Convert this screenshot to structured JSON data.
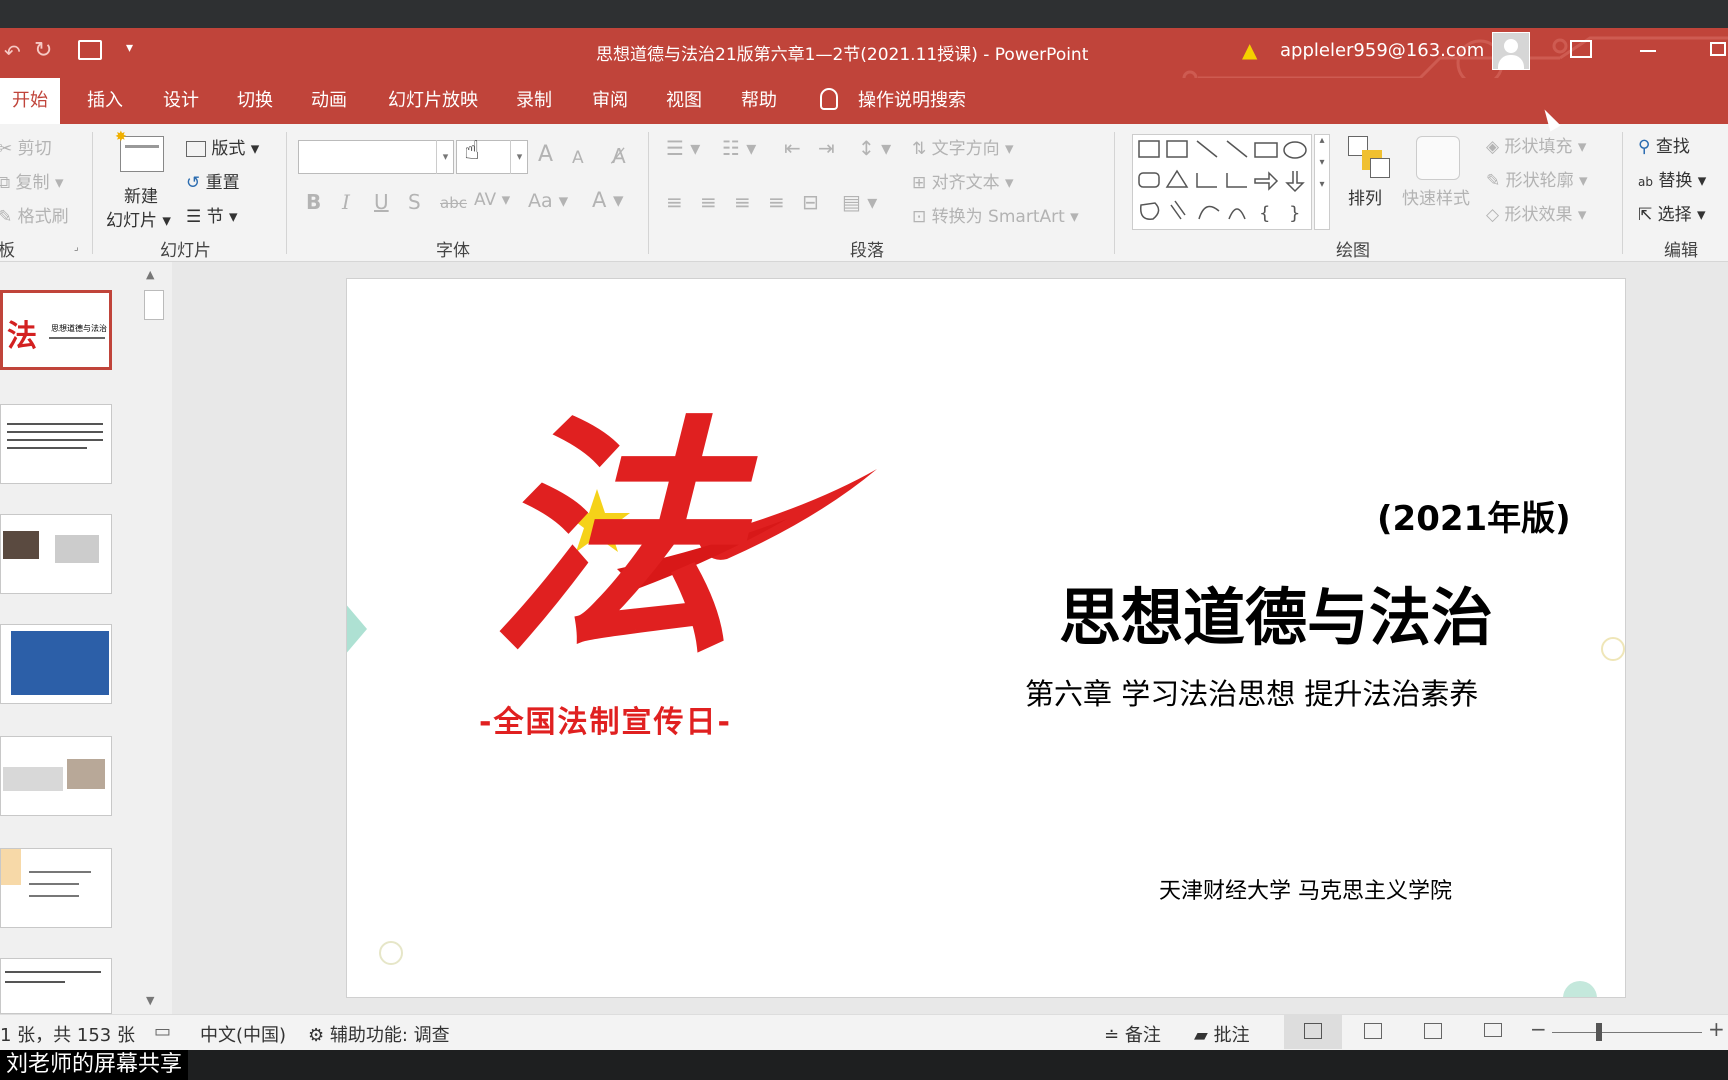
{
  "window": {
    "title": "思想道德与法治21版第六章1—2节(2021.11授课)   -  PowerPoint",
    "account": "appleler959@163.com"
  },
  "tabs": [
    "开始",
    "插入",
    "设计",
    "切换",
    "动画",
    "幻灯片放映",
    "录制",
    "审阅",
    "视图",
    "帮助"
  ],
  "search_label": "操作说明搜索",
  "ribbon": {
    "clipboard": {
      "cut": "剪切",
      "copy": "复制",
      "format_painter": "格式刷",
      "label": "板"
    },
    "slides": {
      "new_slide_line1": "新建",
      "new_slide_line2": "幻灯片",
      "layout": "版式",
      "reset": "重置",
      "section": "节",
      "label": "幻灯片"
    },
    "font": {
      "label": "字体",
      "bold": "B",
      "italic": "I",
      "underline": "U",
      "strike": "S",
      "strike2": "abc",
      "spacing": "AV",
      "case": "Aa",
      "color": "A",
      "grow": "A",
      "shrink": "A"
    },
    "paragraph": {
      "text_direction": "文字方向",
      "align_text": "对齐文本",
      "smartart": "转换为 SmartArt",
      "label": "段落"
    },
    "drawing": {
      "arrange": "排列",
      "quick_styles": "快速样式",
      "shape_fill": "形状填充",
      "shape_outline": "形状轮廓",
      "shape_effects": "形状效果",
      "label": "绘图"
    },
    "editing": {
      "find": "查找",
      "replace": "替换",
      "select": "选择",
      "label": "编辑"
    }
  },
  "slide": {
    "edition": "(2021年版)",
    "title": "思想道德与法治",
    "subtitle": "第六章  学习法治思想  提升法治素养",
    "school": "天津财经大学  马克思主义学院",
    "logo_text": "-全国法制宣传日-",
    "logo_char": "法"
  },
  "thumbnails": {
    "first_title": "思想道德与法治"
  },
  "status": {
    "slide_count": "1 张，共 153 张",
    "language": "中文(中国)",
    "accessibility": "辅助功能: 调查",
    "notes": "备注",
    "comments": "批注"
  },
  "share_banner": "刘老师的屏幕共享",
  "colors": {
    "accent": "#c0443a",
    "ribbon_bg": "#f3f3f3"
  }
}
